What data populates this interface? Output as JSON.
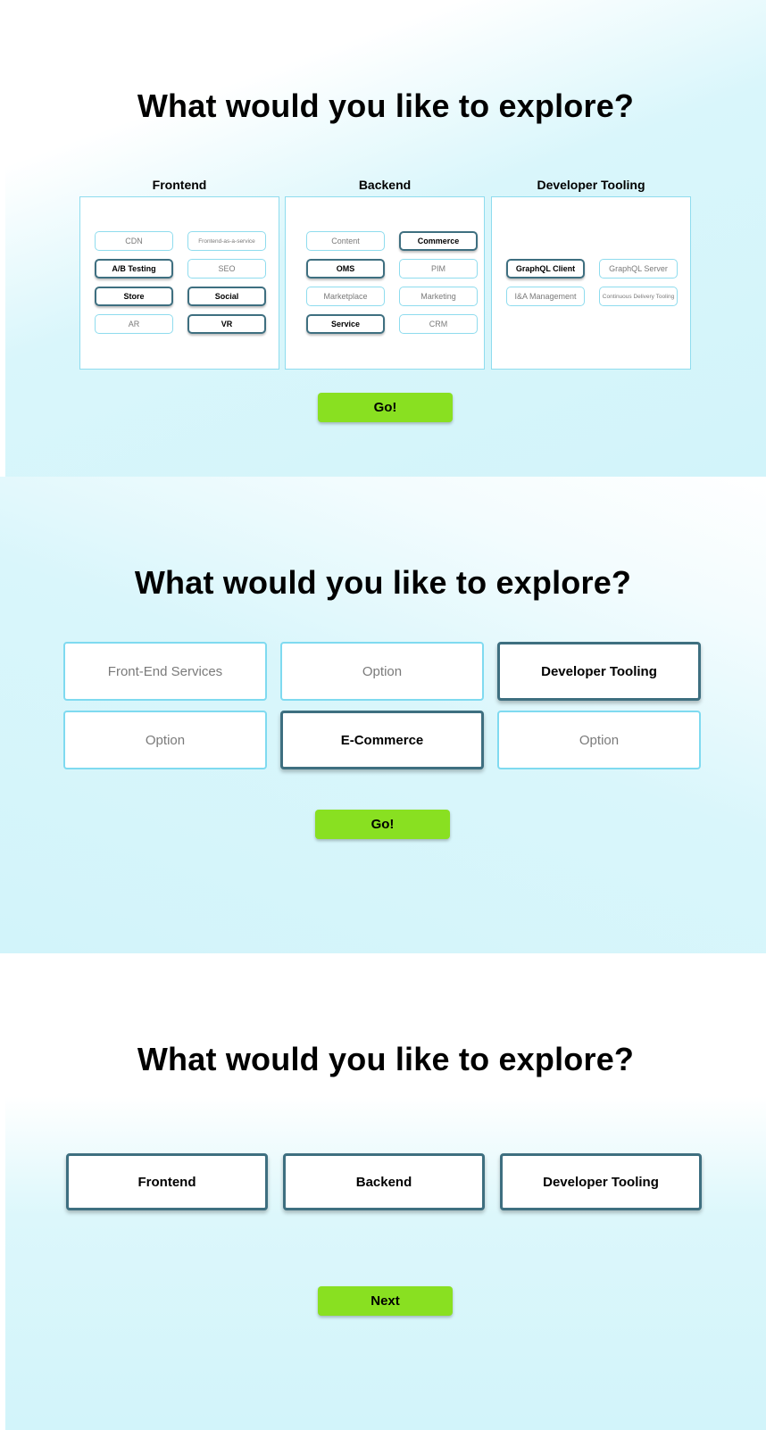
{
  "panel1": {
    "heading": "What would you like to explore?",
    "columns": [
      {
        "title": "Frontend",
        "chips": [
          {
            "label": "CDN",
            "selected": false
          },
          {
            "label": "Frontend-as-a-service",
            "selected": false
          },
          {
            "label": "A/B Testing",
            "selected": true
          },
          {
            "label": "SEO",
            "selected": false
          },
          {
            "label": "Store",
            "selected": true
          },
          {
            "label": "Social",
            "selected": true
          },
          {
            "label": "AR",
            "selected": false
          },
          {
            "label": "VR",
            "selected": true
          }
        ]
      },
      {
        "title": "Backend",
        "chips": [
          {
            "label": "Content",
            "selected": false
          },
          {
            "label": "Commerce",
            "selected": true
          },
          {
            "label": "OMS",
            "selected": true
          },
          {
            "label": "PIM",
            "selected": false
          },
          {
            "label": "Marketplace",
            "selected": false
          },
          {
            "label": "Marketing",
            "selected": false
          },
          {
            "label": "Service",
            "selected": true
          },
          {
            "label": "CRM",
            "selected": false
          }
        ]
      },
      {
        "title": "Developer Tooling",
        "chips": [
          {
            "label": "GraphQL Client",
            "selected": true
          },
          {
            "label": "GraphQL Server",
            "selected": false
          },
          {
            "label": "I&A Management",
            "selected": false
          },
          {
            "label": "Continuous Delivery Tooling",
            "selected": false
          }
        ]
      }
    ],
    "go_label": "Go!"
  },
  "panel2": {
    "heading": "What would you like to explore?",
    "options": [
      {
        "label": "Front-End Services",
        "selected": false
      },
      {
        "label": "Option",
        "selected": false
      },
      {
        "label": "Developer Tooling",
        "selected": true
      },
      {
        "label": "Option",
        "selected": false
      },
      {
        "label": "E-Commerce",
        "selected": true
      },
      {
        "label": "Option",
        "selected": false
      }
    ],
    "go_label": "Go!"
  },
  "panel3": {
    "heading": "What would you like to explore?",
    "categories": [
      {
        "label": "Frontend"
      },
      {
        "label": "Backend"
      },
      {
        "label": "Developer Tooling"
      }
    ],
    "next_label": "Next"
  },
  "colors": {
    "accent_green": "#89e021",
    "selected_border": "#3e6f80",
    "unselected_border": "#8fdcee",
    "background_tint": "#d2f4fa"
  }
}
